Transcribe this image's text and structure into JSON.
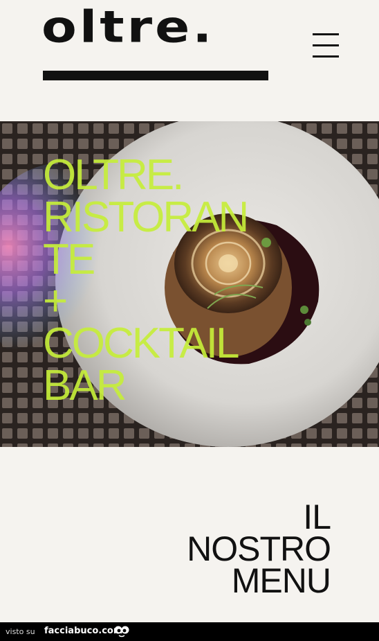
{
  "header": {
    "logo_text": "oltre.",
    "menu_icon": "hamburger-icon"
  },
  "hero": {
    "title_lines": [
      "OLTRE.",
      "RISTORAN",
      "TE",
      "+",
      "COCKTAIL",
      "BAR"
    ],
    "title_color": "#c6ee3a",
    "image": "plated-dish-photo"
  },
  "menu_link": {
    "lines": [
      "IL",
      "NOSTRO",
      "MENU"
    ]
  },
  "footer": {
    "visto_su": "visto su",
    "site": "facciabuco.com",
    "eyes_icon": "eyes-icon"
  },
  "colors": {
    "background": "#f5f3ef",
    "text": "#111111",
    "footer": "#000000"
  }
}
